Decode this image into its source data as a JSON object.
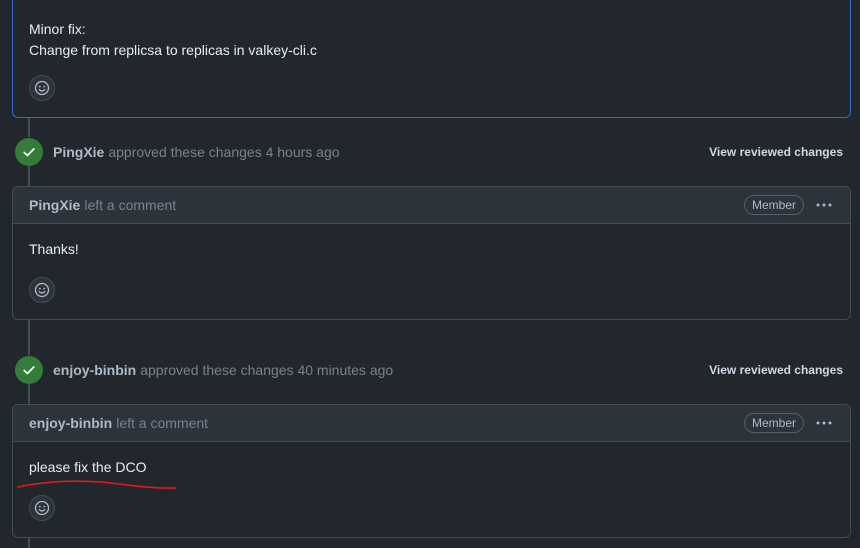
{
  "top_comment": {
    "lines": [
      "Minor fix:",
      "Change from replicsa to replicas in valkey-cli.c"
    ]
  },
  "events": [
    {
      "author": "PingXie",
      "action": "approved these changes 4 hours ago",
      "view_label": "View reviewed changes",
      "comment": {
        "author": "PingXie",
        "action": "left a comment",
        "badge": "Member",
        "body": "Thanks!"
      }
    },
    {
      "author": "enjoy-binbin",
      "action": "approved these changes 40 minutes ago",
      "view_label": "View reviewed changes",
      "comment": {
        "author": "enjoy-binbin",
        "action": "left a comment",
        "badge": "Member",
        "body": "please fix the DCO"
      }
    }
  ],
  "colors": {
    "background": "#22272e",
    "approve_green": "#347d39",
    "annotation_red": "#e5191f"
  },
  "icons": {
    "reaction": "smiley-icon",
    "approve": "check-icon",
    "menu": "kebab-horizontal-icon"
  }
}
